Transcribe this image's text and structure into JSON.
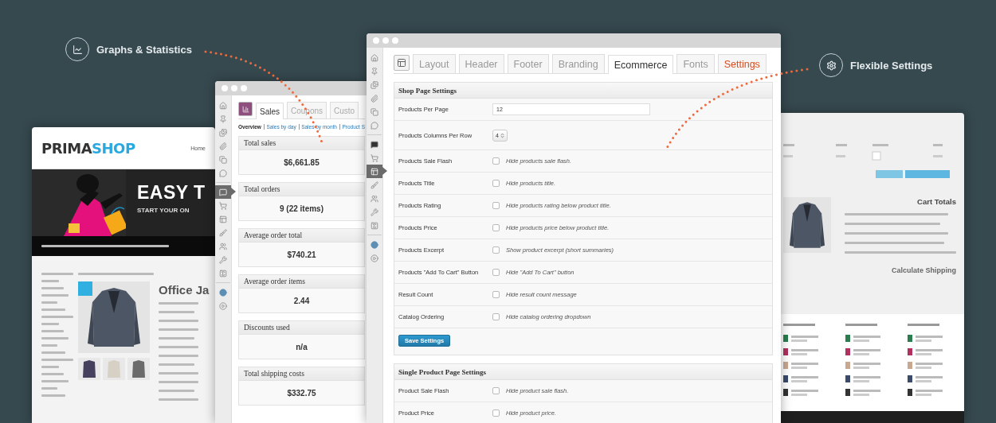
{
  "callouts": [
    {
      "kind": "chart",
      "label": "Graphs & Statistics"
    },
    {
      "kind": "gear",
      "label": "Flexible Settings"
    }
  ],
  "shop_window": {
    "logo_dark": "PRIMA",
    "logo_light": "SHOP",
    "nav_link": "Home",
    "banner_title": "EASY T",
    "banner_subtitle": "START YOUR ON",
    "product_title": "Office Ja"
  },
  "sales_window": {
    "sidebar": [
      {
        "selected": false
      },
      {
        "selected": false
      },
      {
        "selected": false
      },
      {
        "selected": false
      },
      {
        "selected": false
      },
      {
        "selected": false
      },
      {
        "selected": true
      },
      {
        "selected": false
      },
      {
        "selected": false
      },
      {
        "selected": false
      },
      {
        "selected": false
      },
      {
        "selected": false
      },
      {
        "selected": false
      },
      {
        "selected": false
      },
      {
        "selected": false
      }
    ],
    "tabs": [
      {
        "label": "Sales",
        "selected": true
      },
      {
        "label": "Coupons",
        "selected": false
      },
      {
        "label": "Custo",
        "selected": false
      }
    ],
    "subnav": [
      {
        "label": "Overview",
        "selected": true
      },
      {
        "label": "Sales by day",
        "selected": false
      },
      {
        "label": "Sales by month",
        "selected": false
      },
      {
        "label": "Product S",
        "selected": false
      }
    ],
    "cards": [
      {
        "title": "Total sales",
        "value": "$6,661.85"
      },
      {
        "title": "Total orders",
        "value": "9 (22 items)"
      },
      {
        "title": "Average order total",
        "value": "$740.21"
      },
      {
        "title": "Average order items",
        "value": "2.44"
      },
      {
        "title": "Discounts used",
        "value": "n/a"
      },
      {
        "title": "Total shipping costs",
        "value": "$332.75"
      }
    ]
  },
  "settings_window": {
    "sidebar": [
      {
        "selected": false
      },
      {
        "selected": false
      },
      {
        "selected": false
      },
      {
        "selected": false
      },
      {
        "selected": false
      },
      {
        "selected": false
      },
      {
        "selected": false
      },
      {
        "selected": false
      },
      {
        "selected": true
      },
      {
        "selected": false
      },
      {
        "selected": false
      },
      {
        "selected": false
      },
      {
        "selected": false
      },
      {
        "selected": false
      },
      {
        "selected": false
      }
    ],
    "tabs": [
      {
        "label": "Layout",
        "selected": false,
        "highlighted": false
      },
      {
        "label": "Header",
        "selected": false,
        "highlighted": false
      },
      {
        "label": "Footer",
        "selected": false,
        "highlighted": false
      },
      {
        "label": "Branding",
        "selected": false,
        "highlighted": false
      },
      {
        "label": "Ecommerce",
        "selected": true,
        "highlighted": false
      },
      {
        "label": "Fonts",
        "selected": false,
        "highlighted": false
      },
      {
        "label": "Settings",
        "selected": false,
        "highlighted": true
      }
    ],
    "sections": [
      {
        "title": "Shop Page Settings",
        "button": "Save Settings",
        "rows": [
          {
            "kind": "text",
            "label": "Products Per Page",
            "value": "12"
          },
          {
            "kind": "select",
            "label": "Products Columns Per Row",
            "value": "4"
          },
          {
            "kind": "checkbox",
            "label": "Products Sale Flash",
            "checked": false,
            "description": "Hide products sale flash."
          },
          {
            "kind": "checkbox",
            "label": "Products Title",
            "checked": false,
            "description": "Hide products title."
          },
          {
            "kind": "checkbox",
            "label": "Products Rating",
            "checked": false,
            "description": "Hide products rating below product title."
          },
          {
            "kind": "checkbox",
            "label": "Products Price",
            "checked": false,
            "description": "Hide products price below product title."
          },
          {
            "kind": "checkbox",
            "label": "Products Excerpt",
            "checked": false,
            "description": "Show product excerpt (short summaries)"
          },
          {
            "kind": "checkbox",
            "label": "Products \"Add To Cart\" Button",
            "checked": false,
            "description": "Hide \"Add To Cart\" button"
          },
          {
            "kind": "checkbox",
            "label": "Result Count",
            "checked": false,
            "description": "Hide result count message"
          },
          {
            "kind": "checkbox",
            "label": "Catalog Ordering",
            "checked": false,
            "description": "Hide catalog ordering dropdown"
          }
        ]
      },
      {
        "title": "Single Product Page Settings",
        "rows": [
          {
            "kind": "checkbox",
            "label": "Product Sale Flash",
            "checked": false,
            "description": "Hide product sale flash."
          },
          {
            "kind": "checkbox",
            "label": "Product Price",
            "checked": false,
            "description": "Hide product price."
          }
        ]
      }
    ]
  },
  "cart_window": {
    "totals_title": "Cart Totals",
    "shipping_title": "Calculate Shipping"
  }
}
